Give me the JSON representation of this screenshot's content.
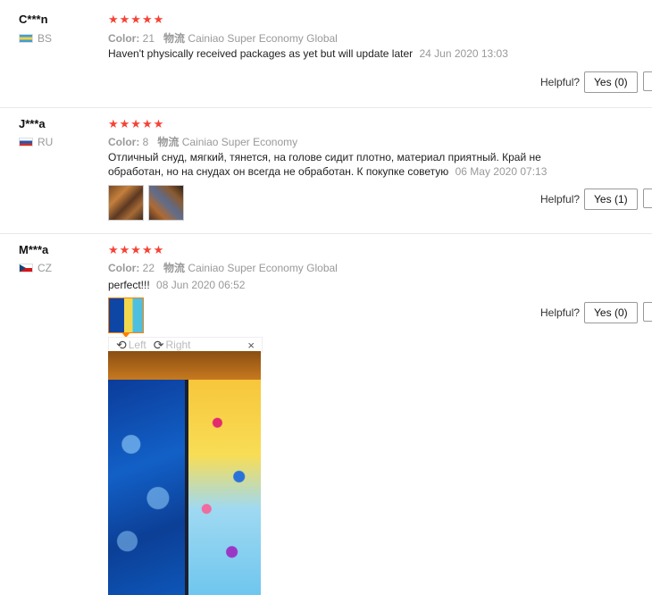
{
  "reviews": [
    {
      "name": "C***n",
      "country": "BS",
      "flag": "bs-flag",
      "stars": "★★★★★",
      "color_label": "Color:",
      "color_value": "21",
      "shipping_label": "物流",
      "shipping_value": "Cainiao Super Economy Global",
      "text": "Haven't physically received packages as yet but will update later",
      "date": "24 Jun 2020 13:03",
      "helpful_label": "Helpful?",
      "yes_label": "Yes (0)"
    },
    {
      "name": "J***a",
      "country": "RU",
      "flag": "ru-flag",
      "stars": "★★★★★",
      "color_label": "Color:",
      "color_value": "8",
      "shipping_label": "物流",
      "shipping_value": "Cainiao Super Economy",
      "text": "Отличный снуд, мягкий, тянется, на голове сидит плотно, материал приятный. Край не обработан, но на снудах он всегда не обработан. К покупке советую",
      "date": "06 May 2020 07:13",
      "helpful_label": "Helpful?",
      "yes_label": "Yes (1)"
    },
    {
      "name": "M***a",
      "country": "CZ",
      "flag": "cz-flag",
      "stars": "★★★★★",
      "color_label": "Color:",
      "color_value": "22",
      "shipping_label": "物流",
      "shipping_value": "Cainiao Super Economy Global",
      "text": "perfect!!!",
      "date": "08 Jun 2020 06:52",
      "helpful_label": "Helpful?",
      "yes_label": "Yes (0)"
    }
  ],
  "viewer": {
    "left_label": "Left",
    "right_label": "Right",
    "close_symbol": "×"
  }
}
